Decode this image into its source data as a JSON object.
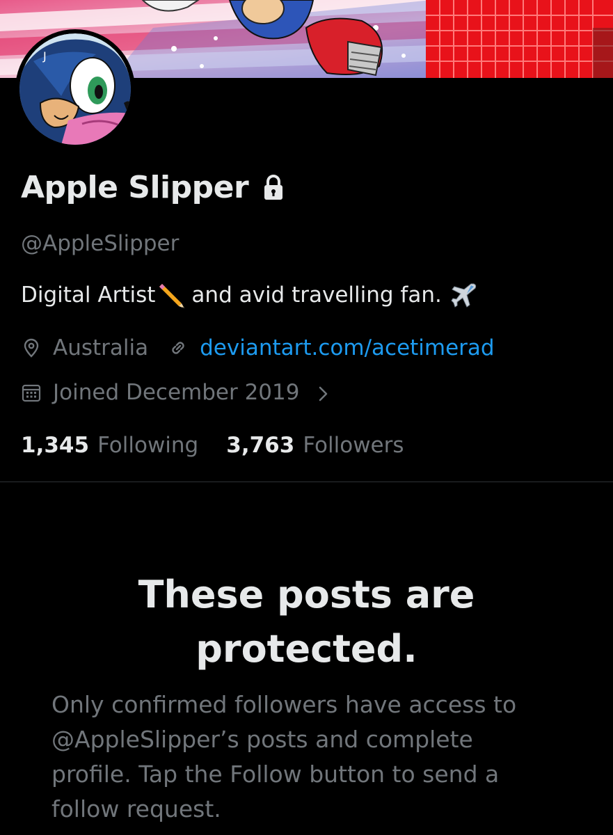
{
  "profile": {
    "display_name": "Apple Slipper",
    "handle": "@AppleSlipper",
    "bio_part1": "Digital Artist",
    "bio_part2": "and avid travelling fan.",
    "location": "Australia",
    "website": "deviantart.com/acetimerad",
    "joined": "Joined December 2019",
    "protected": true,
    "icons": {
      "lock": "lock-icon",
      "location": "location-pin-icon",
      "link": "link-icon",
      "calendar": "calendar-icon",
      "chevron": "chevron-right-icon",
      "pencil_emoji": "pencil-emoji",
      "airplane_emoji": "airplane-emoji"
    }
  },
  "stats": {
    "following_count": "1,345",
    "following_label": "Following",
    "followers_count": "3,763",
    "followers_label": "Followers"
  },
  "protected_notice": {
    "title_line1": "These posts are",
    "title_line2": "protected.",
    "description": "Only confirmed followers have access to @AppleSlipper’s posts and complete profile. Tap the Follow button to send a follow request."
  },
  "colors": {
    "background": "#000000",
    "primary_text": "#e7e9ea",
    "secondary_text": "#71767b",
    "link": "#1d9bf0",
    "divider": "#2f3336"
  }
}
